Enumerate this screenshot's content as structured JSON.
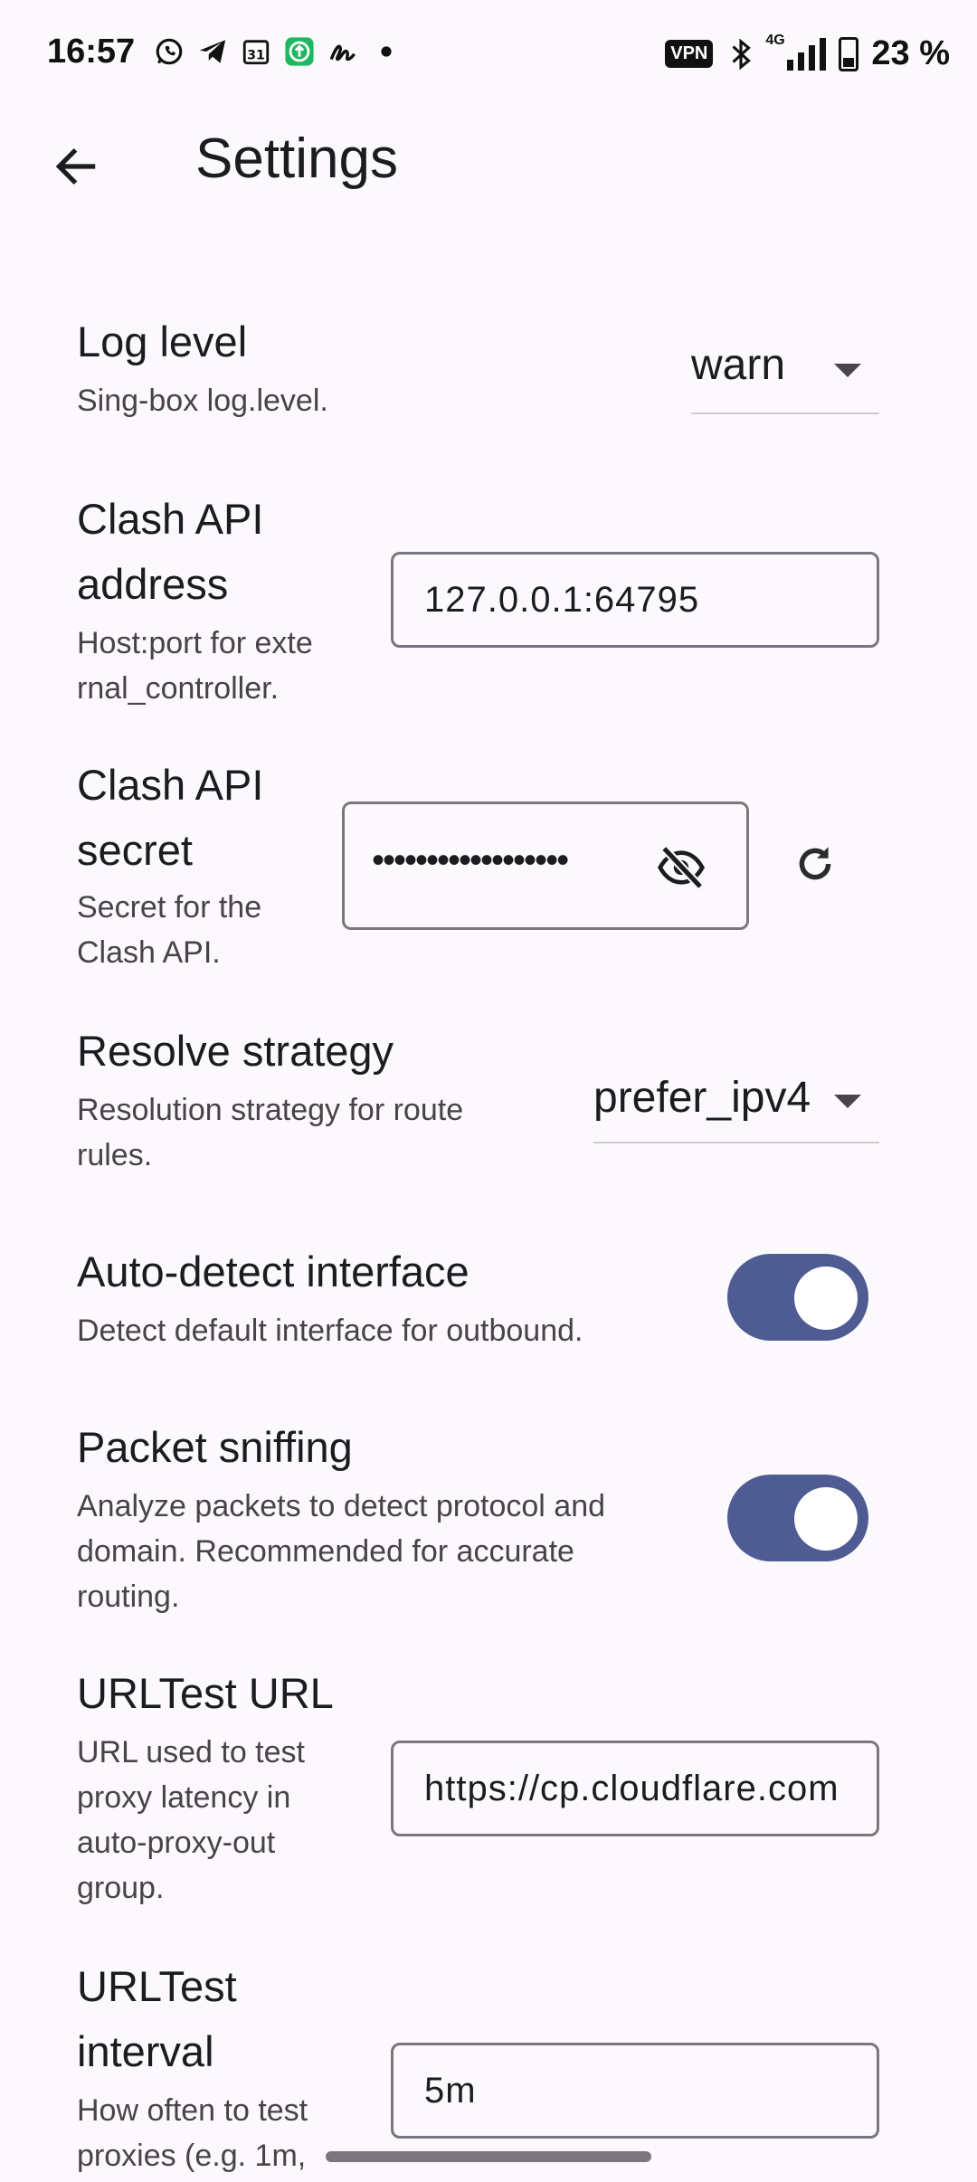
{
  "status_bar": {
    "time": "16:57",
    "vpn": "VPN",
    "network": "4G",
    "battery": "23 %",
    "left_icons": [
      "whatsapp-icon",
      "telegram-icon",
      "calendar-icon",
      "upload-icon",
      "signature-icon",
      "dot-icon"
    ],
    "calendar_day": "31"
  },
  "app_bar": {
    "title": "Settings"
  },
  "settings": {
    "log_level": {
      "title": "Log level",
      "subtitle": "Sing-box log.level.",
      "value": "warn"
    },
    "clash_api_address": {
      "title_1": "Clash API",
      "title_2": "address",
      "subtitle_1": "Host:port for exte",
      "subtitle_2": "rnal_controller.",
      "value": "127.0.0.1:64795"
    },
    "clash_api_secret": {
      "title_1": "Clash API",
      "title_2": "secret",
      "subtitle_1": "Secret for the",
      "subtitle_2": "Clash API.",
      "value": "••••••••••••••••••"
    },
    "resolve_strategy": {
      "title": "Resolve strategy",
      "subtitle_1": "Resolution strategy for route",
      "subtitle_2": "rules.",
      "value": "prefer_ipv4"
    },
    "auto_detect_interface": {
      "title": "Auto-detect interface",
      "subtitle": "Detect default interface for outbound.",
      "enabled": true
    },
    "packet_sniffing": {
      "title": "Packet sniffing",
      "subtitle_1": "Analyze packets to detect protocol and",
      "subtitle_2": "domain. Recommended for accurate",
      "subtitle_3": "routing.",
      "enabled": true
    },
    "urltest_url": {
      "title": "URLTest URL",
      "subtitle_1": "URL used to test",
      "subtitle_2": "proxy latency in",
      "subtitle_3": "auto-proxy-out",
      "subtitle_4": "group.",
      "value": "https://cp.cloudflare.com"
    },
    "urltest_interval": {
      "title_1": "URLTest",
      "title_2": "interval",
      "subtitle_1": "How often to test",
      "subtitle_2": "proxies (e.g. 1m,",
      "value": "5m"
    }
  },
  "colors": {
    "accent": "#4f5b93",
    "background": "#fcf9fc",
    "outline": "#7a757f"
  }
}
